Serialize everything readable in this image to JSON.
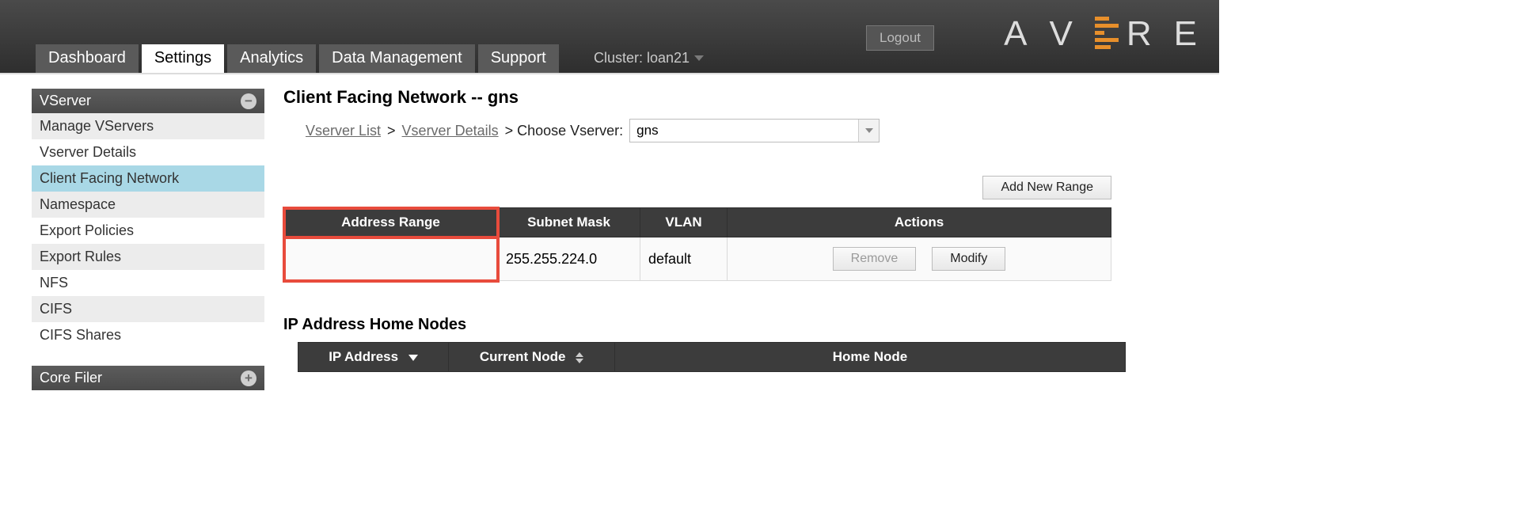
{
  "header": {
    "tabs": [
      "Dashboard",
      "Settings",
      "Analytics",
      "Data Management",
      "Support"
    ],
    "active_tab_index": 1,
    "cluster_label": "Cluster: loan21",
    "logout": "Logout",
    "brand_letters": [
      "A",
      "V",
      "R",
      "E"
    ]
  },
  "sidebar": {
    "group1": {
      "title": "VServer",
      "collapse_icon": "minus-icon"
    },
    "items": [
      "Manage VServers",
      "Vserver Details",
      "Client Facing Network",
      "Namespace",
      "Export Policies",
      "Export Rules",
      "NFS",
      "CIFS",
      "CIFS Shares"
    ],
    "selected_index": 2,
    "group2": {
      "title": "Core Filer",
      "expand_icon": "plus-icon"
    }
  },
  "page": {
    "title": "Client Facing Network -- gns",
    "breadcrumb": {
      "link1": "Vserver List",
      "sep": ">",
      "link2": "Vserver Details",
      "tail": "> Choose Vserver:"
    },
    "vserver_select_value": "gns",
    "add_range": "Add New Range",
    "addr_table": {
      "headers": [
        "Address Range",
        "Subnet Mask",
        "VLAN",
        "Actions"
      ],
      "row": {
        "address_range": "",
        "subnet_mask": "255.255.224.0",
        "vlan": "default",
        "remove": "Remove",
        "modify": "Modify"
      }
    },
    "section2_title": "IP Address Home Nodes",
    "ip_table_headers": [
      "IP Address",
      "Current Node",
      "Home Node"
    ]
  }
}
